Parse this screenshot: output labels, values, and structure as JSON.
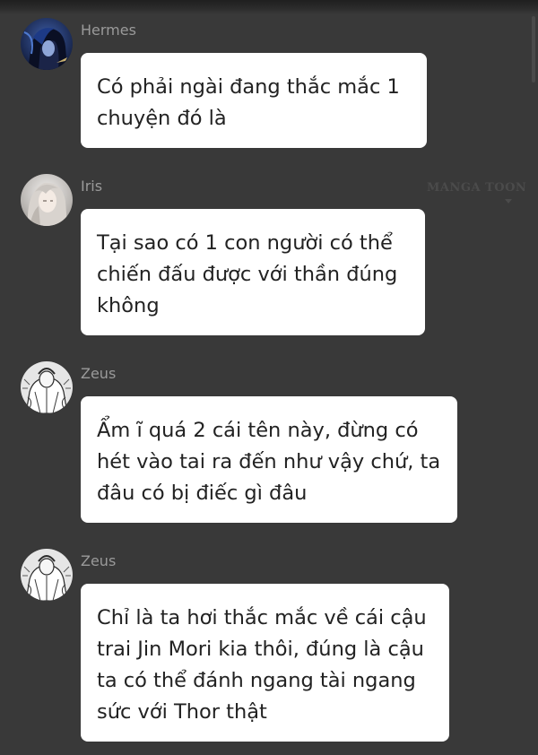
{
  "messages": [
    {
      "sender": "Hermes",
      "avatar_icon": "hermes-avatar-icon",
      "text": "Có phải ngài đang thắc mắc 1\nchuyện đó là"
    },
    {
      "sender": "Iris",
      "avatar_icon": "iris-avatar-icon",
      "text": "Tại sao có 1 con người có thể\nchiến đấu được với thần đúng\nkhông"
    },
    {
      "sender": "Zeus",
      "avatar_icon": "zeus-avatar-icon",
      "text": "Ẩm ĩ quá 2 cái tên này, đừng có\nhét vào tai ra đến như vậy chứ, ta\nđâu có bị điếc gì đâu"
    },
    {
      "sender": "Zeus",
      "avatar_icon": "zeus-avatar-icon",
      "text": "Chỉ là ta hơi thắc mắc về cái cậu\ntrai Jin Mori kia thôi, đúng là cậu\nta có thể đánh ngang tài ngang\nsức với Thor thật"
    }
  ],
  "watermark": "MANGA TOON",
  "colors": {
    "background": "#393939",
    "bubble": "#ffffff",
    "name": "#9a9a9a",
    "text": "#222222"
  }
}
